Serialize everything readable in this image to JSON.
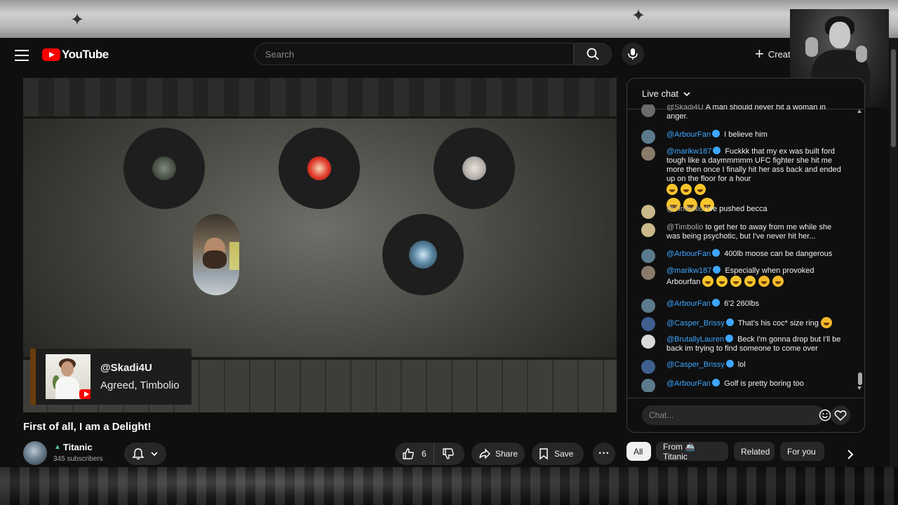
{
  "header": {
    "logo_text": "YouTube",
    "search_placeholder": "Search",
    "create_label": "Create"
  },
  "player": {
    "stage_avatars": [
      "avatar-1",
      "avatar-2",
      "avatar-3",
      "avatar-4"
    ],
    "comment_banner": {
      "user": "@Skadi4U",
      "message": "Agreed, Timbolio"
    }
  },
  "video": {
    "title": "First of all, I am a Delight!",
    "channel_name": "Titanic",
    "subscribers": "345 subscribers",
    "like_count": "6",
    "share_label": "Share",
    "save_label": "Save"
  },
  "chips": [
    {
      "label": "All",
      "active": true
    },
    {
      "label": "From 🚢 Titanic",
      "active": false
    },
    {
      "label": "Related",
      "active": false
    },
    {
      "label": "For you",
      "active": false
    }
  ],
  "chat": {
    "header_title": "Live chat",
    "input_placeholder": "Chat...",
    "messages": [
      {
        "user": "@Skadi4U",
        "verified": false,
        "text": "A man should never hit a woman in anger."
      },
      {
        "user": "@ArbourFan",
        "verified": true,
        "text": "I believe him"
      },
      {
        "user": "@marikw187",
        "verified": true,
        "text": "Fuckkk that my ex was built ford tough like a daymmmmm UFC fighter she hit me more then once I finally hit her ass back and ended up on the floor for a hour"
      },
      {
        "user": "@Timbolio",
        "verified": false,
        "text": "I've pushed becca"
      },
      {
        "user": "@Timbolio",
        "verified": false,
        "text": "to get her to away from me while she was being psychotic, but I've never hit her..."
      },
      {
        "user": "@ArbourFan",
        "verified": true,
        "text": "400lb moose can be dangerous"
      },
      {
        "user": "@marikw187",
        "verified": true,
        "text": "Especially when provoked Arbourfan"
      },
      {
        "user": "@ArbourFan",
        "verified": true,
        "text": "6'2 260lbs"
      },
      {
        "user": "@Casper_Brissy",
        "verified": true,
        "text": "That's his coc* size ring"
      },
      {
        "user": "@BrutallyLauren",
        "verified": true,
        "text": "Beck I'm gonna drop but I'll be back im trying to find someone to come over"
      },
      {
        "user": "@Casper_Brissy",
        "verified": true,
        "text": "lol"
      },
      {
        "user": "@ArbourFan",
        "verified": true,
        "text": "Golf is pretty boring too"
      }
    ]
  }
}
